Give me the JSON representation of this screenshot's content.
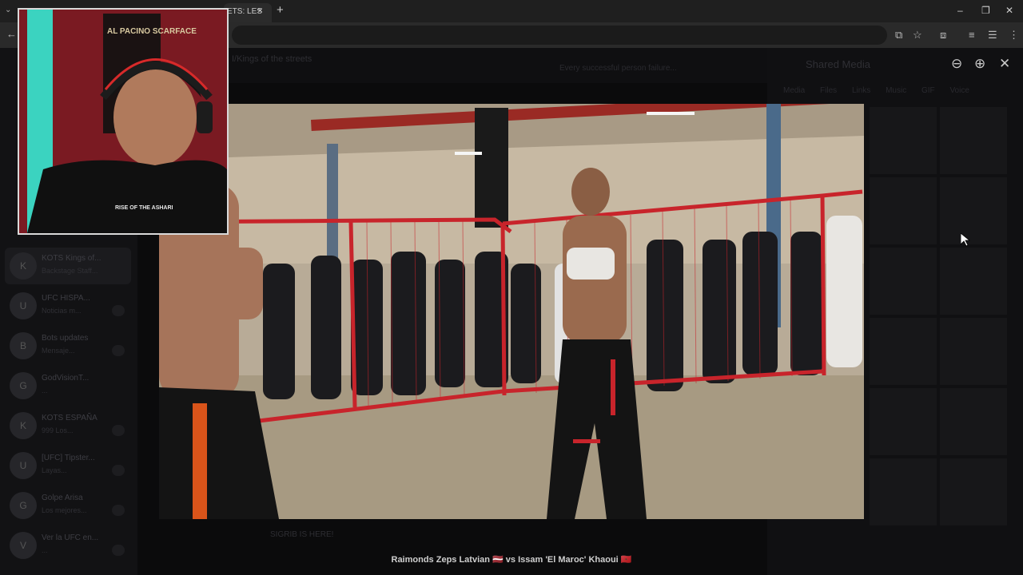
{
  "browser": {
    "tab_title": "ETS: LES",
    "tab_close": "×",
    "new_tab": "+",
    "window_controls": [
      "–",
      "❐",
      "✕"
    ]
  },
  "icons": {
    "tab_search": "tab-search-icon",
    "back": "back-arrow-icon",
    "install": "install-app-icon",
    "bookmark": "star-icon",
    "extensions": "puzzle-icon",
    "menu": "kebab-menu-icon",
    "zoom_out": "zoom-out-icon",
    "zoom_in": "zoom-in-icon",
    "close": "close-icon"
  },
  "sidebar": {
    "items": [
      {
        "name": "KOTS Kings of...",
        "preview": "Backstage Staff..."
      },
      {
        "name": "UFC HISPA...",
        "preview": "Noticias m..."
      },
      {
        "name": "Bots updates",
        "preview": "Mensaje..."
      },
      {
        "name": "GodVisionT...",
        "preview": "..."
      },
      {
        "name": "KOTS ESPAÑA",
        "preview": "999 Los..."
      },
      {
        "name": "[UFC] Tipster...",
        "preview": "Layas..."
      },
      {
        "name": "Golpe Arisa",
        "preview": "Los mejores..."
      },
      {
        "name": "Ver la UFC en...",
        "preview": "..."
      }
    ]
  },
  "conversation": {
    "title": "I/Kings of the streets",
    "pinned": "Every successful person failure...",
    "footer": "SIGRIB IS HERE!"
  },
  "shared_media": {
    "title": "Shared Media",
    "tabs": [
      "Media",
      "Files",
      "Links",
      "Music",
      "GIF",
      "Voice"
    ]
  },
  "webcam": {
    "poster_text": "AL PACINO SCARFACE",
    "shirt_text": "RISE OF THE ASHARI"
  },
  "video": {
    "caption": "Raimonds Zeps Latvian 🇱🇻 vs Issam 'El Maroc' Khaoui 🇲🇦"
  },
  "colors": {
    "fence": "#c8242b",
    "background": "#0e0e10",
    "webcam_border": "#d9d9d9"
  }
}
